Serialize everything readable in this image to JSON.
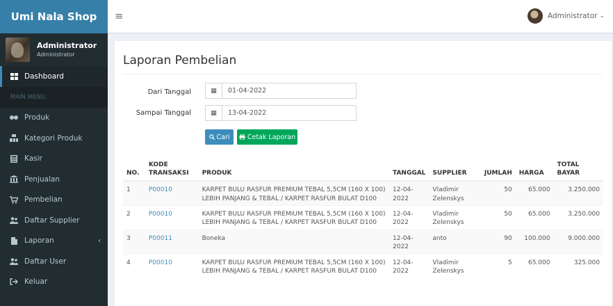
{
  "brand": "Umi Nala Shop",
  "user": {
    "name": "Administrator",
    "role": "Administrator"
  },
  "menu": {
    "header": "MAIN MENU",
    "dashboard": "Dashboard",
    "items": [
      {
        "label": "Produk",
        "icon": "cubes-icon"
      },
      {
        "label": "Kategori Produk",
        "icon": "sitemap-icon"
      },
      {
        "label": "Kasir",
        "icon": "calculator-icon"
      },
      {
        "label": "Penjualan",
        "icon": "bank-icon"
      },
      {
        "label": "Pembelian",
        "icon": "cart-icon"
      },
      {
        "label": "Daftar Supplier",
        "icon": "users-icon"
      },
      {
        "label": "Laporan",
        "icon": "file-icon"
      },
      {
        "label": "Daftar User",
        "icon": "users-icon"
      },
      {
        "label": "Keluar",
        "icon": "sign-out-icon"
      }
    ]
  },
  "account": {
    "name": "Administrator"
  },
  "page": {
    "title": "Laporan Pembelian"
  },
  "filter": {
    "dari_label": "Dari Tanggal",
    "dari_value": "01-04-2022",
    "sampai_label": "Sampai Tanggal",
    "sampai_value": "13-04-2022",
    "cari_label": "Cari",
    "cetak_label": "Cetak Laporan"
  },
  "table": {
    "headers": {
      "no": "NO.",
      "kode_1": "KODE",
      "kode_2": "TRANSAKSI",
      "produk": "PRODUK",
      "tanggal": "TANGGAL",
      "supplier": "SUPPLIER",
      "jumlah": "JUMLAH",
      "harga": "HARGA",
      "total_1": "TOTAL",
      "total_2": "BAYAR"
    },
    "rows": [
      {
        "no": "1",
        "kode": "P00010",
        "produk_1": "KARPET BULU RASFUR PREMIUM TEBAL 5,5CM (160 X 100)",
        "produk_2": "LEBIH PANJANG & TEBAL / KARPET RASFUR BULAT D100",
        "tanggal_1": "12-04-",
        "tanggal_2": "2022",
        "supplier_1": "Vladimir",
        "supplier_2": "Zelenskys",
        "jumlah": "50",
        "harga": "65.000",
        "total": "3.250.000"
      },
      {
        "no": "2",
        "kode": "P00010",
        "produk_1": "KARPET BULU RASFUR PREMIUM TEBAL 5,5CM (160 X 100)",
        "produk_2": "LEBIH PANJANG & TEBAL / KARPET RASFUR BULAT D100",
        "tanggal_1": "12-04-",
        "tanggal_2": "2022",
        "supplier_1": "Vladimir",
        "supplier_2": "Zelenskys",
        "jumlah": "50",
        "harga": "65.000",
        "total": "3.250.000"
      },
      {
        "no": "3",
        "kode": "P00011",
        "produk_1": "Boneka",
        "produk_2": "",
        "tanggal_1": "12-04-",
        "tanggal_2": "2022",
        "supplier_1": "anto",
        "supplier_2": "",
        "jumlah": "90",
        "harga": "100.000",
        "total": "9.000.000"
      },
      {
        "no": "4",
        "kode": "P00010",
        "produk_1": "KARPET BULU RASFUR PREMIUM TEBAL 5,5CM (160 X 100)",
        "produk_2": "LEBIH PANJANG & TEBAL / KARPET RASFUR BULAT D100",
        "tanggal_1": "12-04-",
        "tanggal_2": "2022",
        "supplier_1": "Vladimir",
        "supplier_2": "Zelenskys",
        "jumlah": "5",
        "harga": "65.000",
        "total": "325.000"
      }
    ]
  }
}
